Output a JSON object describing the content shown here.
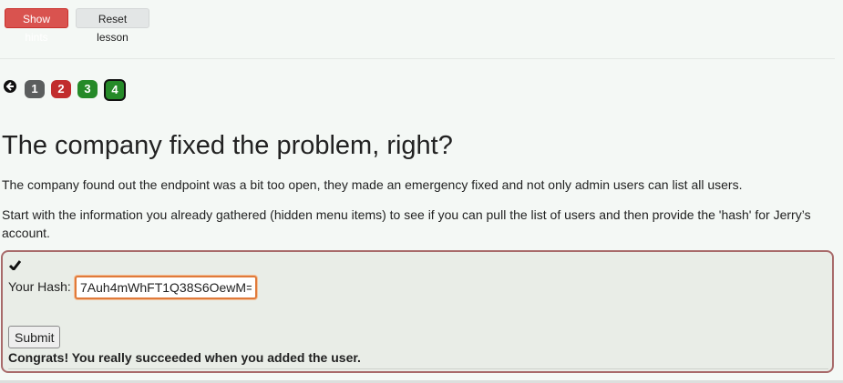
{
  "toolbar": {
    "show_hints_label": "Show hints",
    "reset_lesson_label": "Reset lesson"
  },
  "pagination": {
    "back_icon": "circle-arrow-left-icon",
    "pages": [
      "1",
      "2",
      "3",
      "4"
    ],
    "page_status": [
      "neutral",
      "failed",
      "solved",
      "current"
    ]
  },
  "lesson": {
    "title": "The company fixed the problem, right?",
    "paragraph1": "The company found out the endpoint was a bit too open, they made an emergency fixed and not only admin users can list all users.",
    "paragraph2": "Start with the information you already gathered (hidden menu items) to see if you can pull the list of users and then provide the 'hash' for Jerry’s account."
  },
  "form": {
    "check_icon": "checkmark-icon",
    "hash_label": "Your Hash:",
    "hash_value": "7Auh4mWhFT1Q38S6OewM=",
    "submit_label": "Submit",
    "feedback": "Congrats! You really succeeded when you added the user."
  },
  "colors": {
    "hints_button": "#d9534f",
    "page_failed": "#c12d2d",
    "page_solved": "#258a28",
    "page_neutral": "#5b5e5e",
    "form_border": "#a86a6a"
  }
}
